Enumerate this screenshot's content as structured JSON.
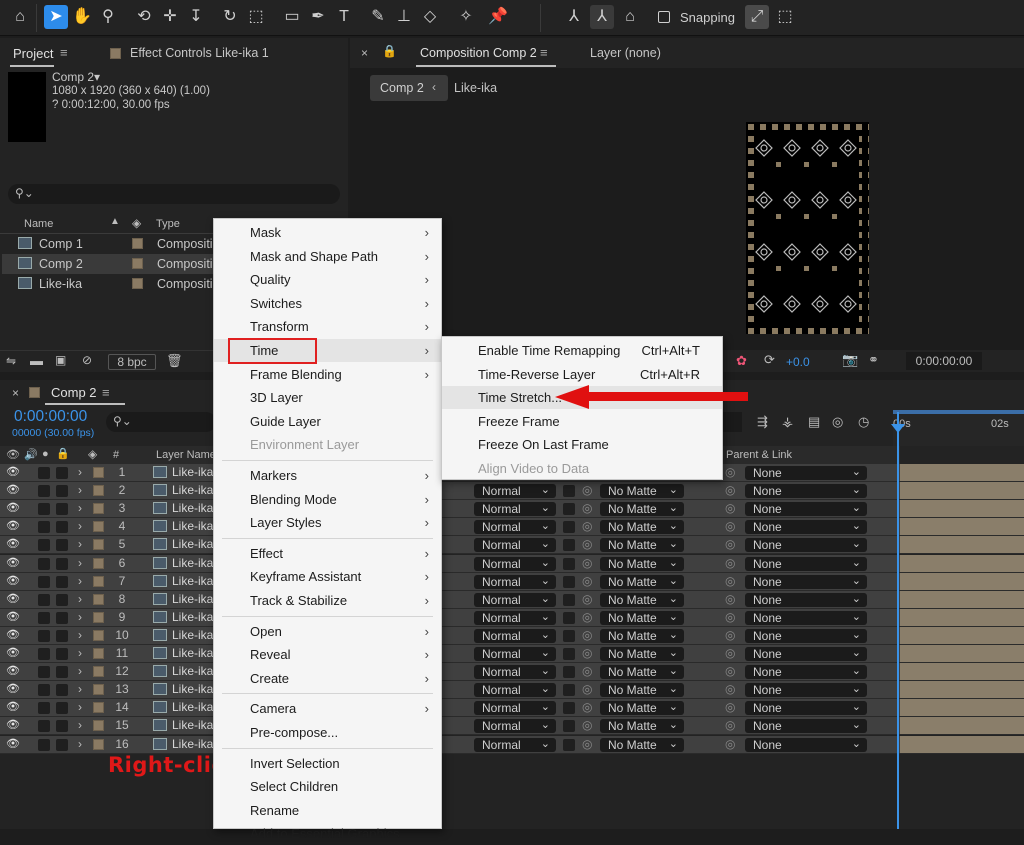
{
  "toolbar": {
    "snapping_label": "Snapping"
  },
  "project_panel": {
    "tab_project": "Project",
    "tab_effect_controls": "Effect Controls Like-ika 1",
    "comp_name": "Comp 2▾",
    "comp_dims": "1080 x 1920  (360 x 640) (1.00)",
    "comp_duration": "? 0:00:12:00, 30.00 fps",
    "search_placeholder": "",
    "col_name": "Name",
    "col_type": "Type",
    "items": [
      {
        "name": "Comp 1",
        "type": "Compositio"
      },
      {
        "name": "Comp 2",
        "type": "Compositio"
      },
      {
        "name": "Like-ika",
        "type": "Compositio"
      }
    ],
    "bpc": "8 bpc"
  },
  "comp_viewer": {
    "tab_label": "Composition Comp 2",
    "layer_tab": "Layer (none)",
    "breadcrumb_1": "Comp 2",
    "breadcrumb_2": "Like-ika",
    "exposure": "+0.0",
    "timecode": "0:00:00:00"
  },
  "timeline": {
    "tab_label": "Comp 2",
    "timecode": "0:00:00:00",
    "frame_info": "00000 (30.00 fps)",
    "col_layer_name": "Layer Name",
    "col_num": "#",
    "col_parent": "Parent & Link",
    "ruler_0": "00s",
    "ruler_2": "02s",
    "mode_value": "Normal",
    "matte_value": "No Matte",
    "parent_value": "None",
    "layer_name": "Like-ika",
    "rows": [
      "1",
      "2",
      "3",
      "4",
      "5",
      "6",
      "7",
      "8",
      "9",
      "10",
      "11",
      "12",
      "13",
      "14",
      "15",
      "16"
    ]
  },
  "annotation": {
    "right_click": "Right-click"
  },
  "context_menu": {
    "items": [
      {
        "label": "Mask",
        "submenu": true
      },
      {
        "label": "Mask and Shape Path",
        "submenu": true
      },
      {
        "label": "Quality",
        "submenu": true
      },
      {
        "label": "Switches",
        "submenu": true
      },
      {
        "label": "Transform",
        "submenu": true
      },
      {
        "label": "Time",
        "submenu": true
      },
      {
        "label": "Frame Blending",
        "submenu": true
      },
      {
        "label": "3D Layer",
        "submenu": false
      },
      {
        "label": "Guide Layer",
        "submenu": false
      },
      {
        "label": "Environment Layer",
        "submenu": false
      },
      {
        "label": "Markers",
        "submenu": true
      },
      {
        "label": "Blending Mode",
        "submenu": true
      },
      {
        "label": "Layer Styles",
        "submenu": true
      },
      {
        "label": "Effect",
        "submenu": true
      },
      {
        "label": "Keyframe Assistant",
        "submenu": true
      },
      {
        "label": "Track & Stabilize",
        "submenu": true
      },
      {
        "label": "Open",
        "submenu": true
      },
      {
        "label": "Reveal",
        "submenu": true
      },
      {
        "label": "Create",
        "submenu": true
      },
      {
        "label": "Camera",
        "submenu": true
      },
      {
        "label": "Pre-compose...",
        "submenu": false
      },
      {
        "label": "Invert Selection",
        "submenu": false
      },
      {
        "label": "Select Children",
        "submenu": false
      },
      {
        "label": "Rename",
        "submenu": false
      },
      {
        "label": "Add to Essential Graphics",
        "submenu": false
      }
    ]
  },
  "time_submenu": {
    "items": [
      {
        "label": "Enable Time Remapping",
        "shortcut": "Ctrl+Alt+T"
      },
      {
        "label": "Time-Reverse Layer",
        "shortcut": "Ctrl+Alt+R"
      },
      {
        "label": "Time Stretch...",
        "shortcut": ""
      },
      {
        "label": "Freeze Frame",
        "shortcut": ""
      },
      {
        "label": "Freeze On Last Frame",
        "shortcut": ""
      },
      {
        "label": "Align Video to Data",
        "shortcut": ""
      }
    ]
  },
  "colors": {
    "accent": "#2d8ceb",
    "highlight_box": "#e02020",
    "arrow": "#e01010",
    "track": "#8a7e6a"
  }
}
